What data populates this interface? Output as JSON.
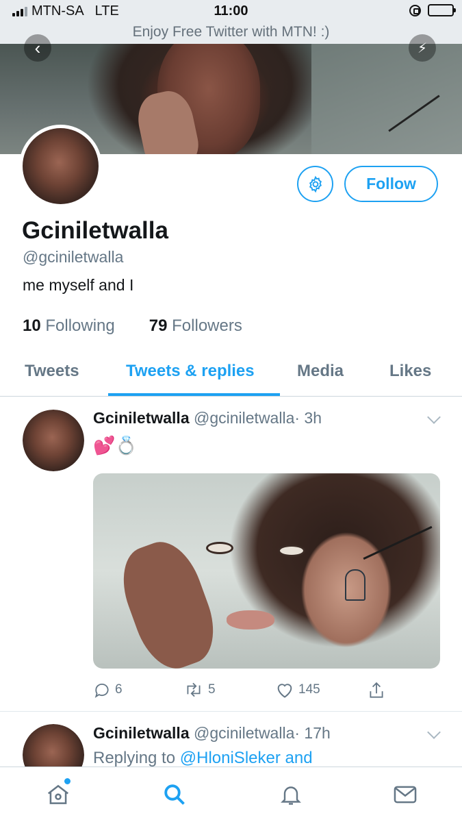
{
  "status_bar": {
    "carrier": "MTN-SA",
    "network": "LTE",
    "time": "11:00",
    "banner": "Enjoy Free Twitter with MTN! :)"
  },
  "profile": {
    "display_name": "Gciniletwalla",
    "handle": "@gciniletwalla",
    "bio": "me myself and I",
    "following_count": "10",
    "following_label": "Following",
    "followers_count": "79",
    "followers_label": "Followers",
    "follow_label": "Follow"
  },
  "tabs": [
    {
      "label": "Tweets"
    },
    {
      "label": "Tweets & replies"
    },
    {
      "label": "Media"
    },
    {
      "label": "Likes"
    }
  ],
  "active_tab": "Tweets & replies",
  "tweets": [
    {
      "name": "Gciniletwalla",
      "handle": "@gciniletwalla",
      "time": "· 3h",
      "text": "💕💍",
      "replies": "6",
      "retweets": "5",
      "likes": "145"
    },
    {
      "name": "Gciniletwalla",
      "handle": "@gciniletwalla",
      "time": "· 17h",
      "replying_prefix": "Replying to",
      "replying_mention": "@HloniSleker and"
    }
  ],
  "colors": {
    "accent": "#1da1f2",
    "muted": "#657786",
    "text": "#14171a"
  },
  "icons": [
    "back-icon",
    "share-icon",
    "gear-icon",
    "chevron-down-icon",
    "reply-icon",
    "retweet-icon",
    "like-icon",
    "share-up-icon",
    "home-icon",
    "search-icon",
    "notifications-icon",
    "messages-icon"
  ]
}
